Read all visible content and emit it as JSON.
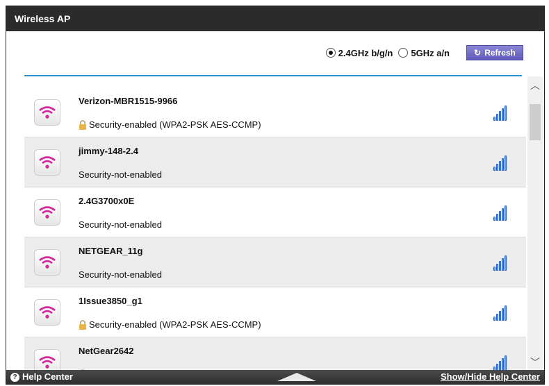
{
  "title": "Wireless AP",
  "bands": {
    "option_24": "2.4GHz b/g/n",
    "option_5": "5GHz a/n",
    "selected": "2.4GHz b/g/n"
  },
  "refresh_label": "Refresh",
  "networks": [
    {
      "ssid": "Verizon-MBR1515-9966",
      "security": "Security-enabled (WPA2-PSK AES-CCMP)",
      "locked": true
    },
    {
      "ssid": "jimmy-148-2.4",
      "security": "Security-not-enabled",
      "locked": false
    },
    {
      "ssid": "2.4G3700x0E",
      "security": "Security-not-enabled",
      "locked": false
    },
    {
      "ssid": "NETGEAR_11g",
      "security": "Security-not-enabled",
      "locked": false
    },
    {
      "ssid": "1Issue3850_g1",
      "security": "Security-enabled (WPA2-PSK AES-CCMP)",
      "locked": true
    },
    {
      "ssid": "NetGear2642",
      "security": "",
      "locked": true
    }
  ],
  "footer": {
    "help_center": "Help Center",
    "show_hide": "Show/Hide Help Center"
  },
  "colors": {
    "accent_line": "#2b8fc4",
    "refresh_button": "#6b66c4",
    "wifi_icon": "#d4269a",
    "signal_bars": "#2a60b8"
  },
  "icons": {
    "wifi": "wifi-icon",
    "lock": "lock-icon",
    "signal": "signal-strength-icon",
    "refresh": "refresh-icon",
    "help": "question-icon"
  }
}
